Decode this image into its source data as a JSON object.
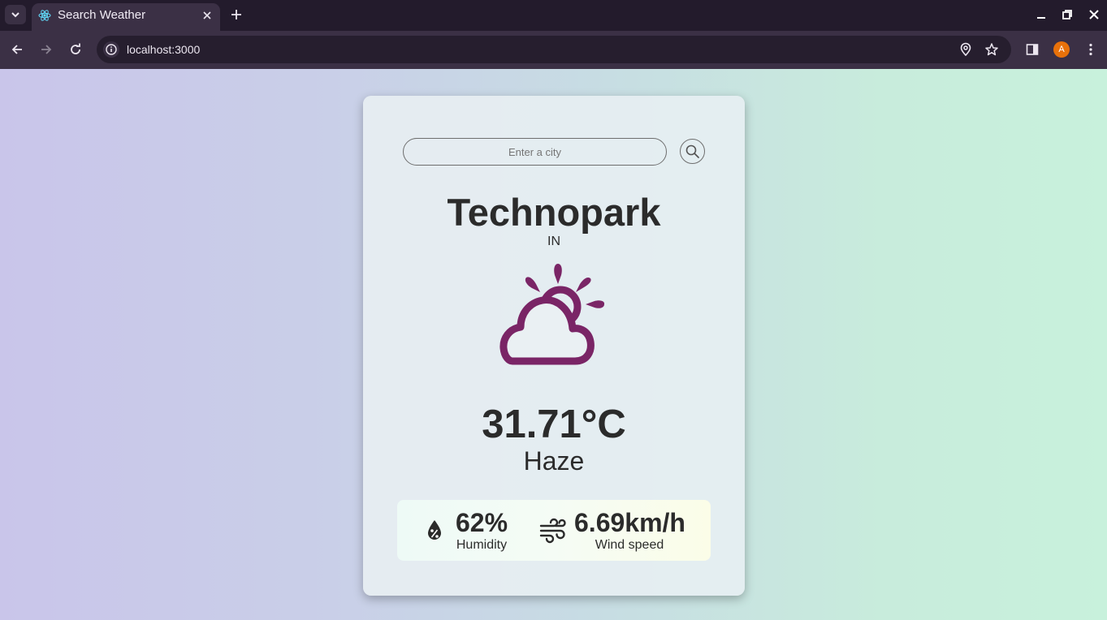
{
  "browser": {
    "tab_title": "Search Weather",
    "url": "localhost:3000",
    "profile_initial": "A"
  },
  "search": {
    "placeholder": "Enter a city",
    "value": ""
  },
  "weather": {
    "city": "Technopark",
    "country": "IN",
    "temperature": "31.71°C",
    "description": "Haze",
    "icon": "sun-behind-cloud-icon",
    "icon_color": "#7a2566"
  },
  "stats": {
    "humidity_value": "62%",
    "humidity_label": "Humidity",
    "wind_value": "6.69km/h",
    "wind_label": "Wind speed"
  }
}
